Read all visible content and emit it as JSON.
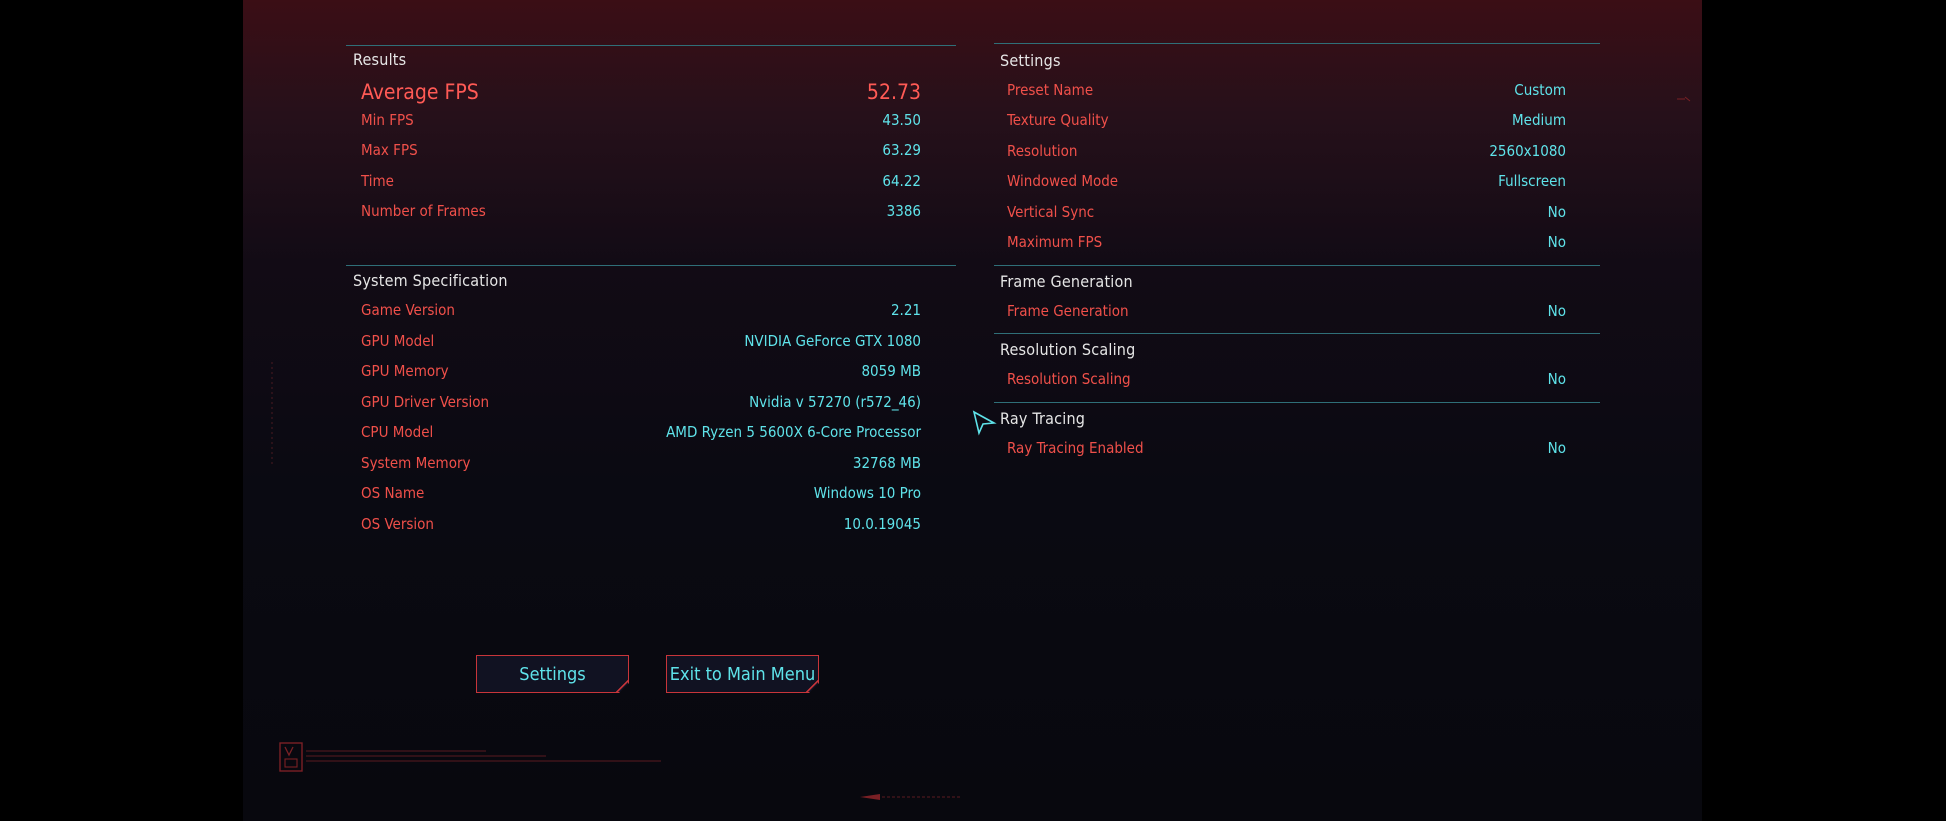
{
  "results": {
    "title": "Results",
    "average_fps": {
      "label": "Average FPS",
      "value": "52.73"
    },
    "rows": [
      {
        "label": "Min FPS",
        "value": "43.50"
      },
      {
        "label": "Max FPS",
        "value": "63.29"
      },
      {
        "label": "Time",
        "value": "64.22"
      },
      {
        "label": "Number of Frames",
        "value": "3386"
      }
    ]
  },
  "system": {
    "title": "System Specification",
    "rows": [
      {
        "label": "Game Version",
        "value": "2.21"
      },
      {
        "label": "GPU Model",
        "value": "NVIDIA GeForce GTX 1080"
      },
      {
        "label": "GPU Memory",
        "value": "8059 MB"
      },
      {
        "label": "GPU Driver Version",
        "value": "Nvidia v 57270 (r572_46)"
      },
      {
        "label": "CPU Model",
        "value": "AMD Ryzen 5 5600X 6-Core Processor"
      },
      {
        "label": "System Memory",
        "value": "32768 MB"
      },
      {
        "label": "OS Name",
        "value": "Windows 10 Pro"
      },
      {
        "label": "OS Version",
        "value": "10.0.19045"
      }
    ]
  },
  "settings": {
    "title": "Settings",
    "rows": [
      {
        "label": "Preset Name",
        "value": "Custom"
      },
      {
        "label": "Texture Quality",
        "value": "Medium"
      },
      {
        "label": "Resolution",
        "value": "2560x1080"
      },
      {
        "label": "Windowed Mode",
        "value": "Fullscreen"
      },
      {
        "label": "Vertical Sync",
        "value": "No"
      },
      {
        "label": "Maximum FPS",
        "value": "No"
      }
    ]
  },
  "frame_generation": {
    "title": "Frame Generation",
    "rows": [
      {
        "label": "Frame Generation",
        "value": "No"
      }
    ]
  },
  "resolution_scaling": {
    "title": "Resolution Scaling",
    "rows": [
      {
        "label": "Resolution Scaling",
        "value": "No"
      }
    ]
  },
  "ray_tracing": {
    "title": "Ray Tracing",
    "rows": [
      {
        "label": "Ray Tracing Enabled",
        "value": "No"
      }
    ]
  },
  "buttons": {
    "settings": "Settings",
    "exit": "Exit to Main Menu"
  },
  "icons": {
    "cursor": "arrow-cursor-icon",
    "version_badge": "version-badge-icon"
  },
  "colors": {
    "label_red": "#f0504a",
    "value_cyan": "#5fe3ea",
    "section_line": "#2f6f78",
    "title_white": "#e6e6e6"
  }
}
